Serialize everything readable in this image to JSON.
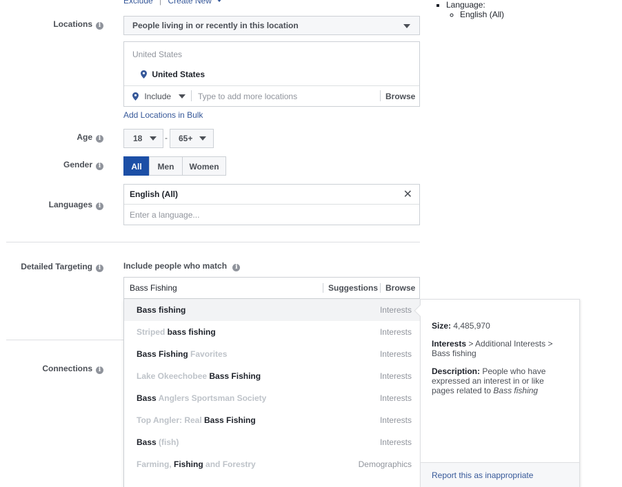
{
  "top": {
    "exclude": "Exclude",
    "separator": "|",
    "create_new": "Create New"
  },
  "locations": {
    "label": "Locations",
    "mode": "People living in or recently in this location",
    "country_group": "United States",
    "selected": "United States",
    "include_label": "Include",
    "placeholder": "Type to add more locations",
    "browse": "Browse",
    "bulk_link": "Add Locations in Bulk"
  },
  "age": {
    "label": "Age",
    "min": "18",
    "dash": "-",
    "max": "65+"
  },
  "gender": {
    "label": "Gender",
    "options": [
      "All",
      "Men",
      "Women"
    ],
    "selected": "All"
  },
  "languages": {
    "label": "Languages",
    "selected": "English (All)",
    "placeholder": "Enter a language..."
  },
  "detailed_targeting": {
    "label": "Detailed Targeting",
    "include_text": "Include people who match",
    "search_value": "Bass Fishing",
    "suggestions": "Suggestions",
    "browse": "Browse",
    "results": [
      {
        "parts": [
          [
            "hi",
            "Bass fishing"
          ]
        ],
        "category": "Interests"
      },
      {
        "parts": [
          [
            "lo",
            "Striped "
          ],
          [
            "hi",
            "bass fishing"
          ]
        ],
        "category": "Interests"
      },
      {
        "parts": [
          [
            "hi",
            "Bass Fishing"
          ],
          [
            "lo",
            " Favorites"
          ]
        ],
        "category": "Interests"
      },
      {
        "parts": [
          [
            "lo",
            "Lake Okeechobee "
          ],
          [
            "hi",
            "Bass Fishing"
          ]
        ],
        "category": "Interests"
      },
      {
        "parts": [
          [
            "hi",
            "Bass"
          ],
          [
            "lo",
            " Anglers Sportsman Society"
          ]
        ],
        "category": "Interests"
      },
      {
        "parts": [
          [
            "lo",
            "Top Angler: Real "
          ],
          [
            "hi",
            "Bass Fishing"
          ]
        ],
        "category": "Interests"
      },
      {
        "parts": [
          [
            "hi",
            "Bass"
          ],
          [
            "lo",
            " (fish)"
          ]
        ],
        "category": "Interests"
      },
      {
        "parts": [
          [
            "lo",
            "Farming, "
          ],
          [
            "hi",
            "Fishing"
          ],
          [
            "lo",
            " and Forestry"
          ]
        ],
        "category": "Demographics"
      }
    ]
  },
  "connections": {
    "label": "Connections"
  },
  "detail_panel": {
    "size_label": "Size:",
    "size_value": "4,485,970",
    "path_bold": "Interests",
    "path_rest": " > Additional Interests > Bass fishing",
    "desc_label": "Description:",
    "desc_text": " People who have expressed an interest in or like pages related to ",
    "desc_italic": "Bass fishing",
    "report_link": "Report this as inappropriate"
  },
  "summary": {
    "language_label": "Language:",
    "language_value": "English (All)"
  },
  "colors": {
    "accent": "#365899",
    "selected_bg": "#1c4fa6",
    "border": "#ccd0d5"
  }
}
